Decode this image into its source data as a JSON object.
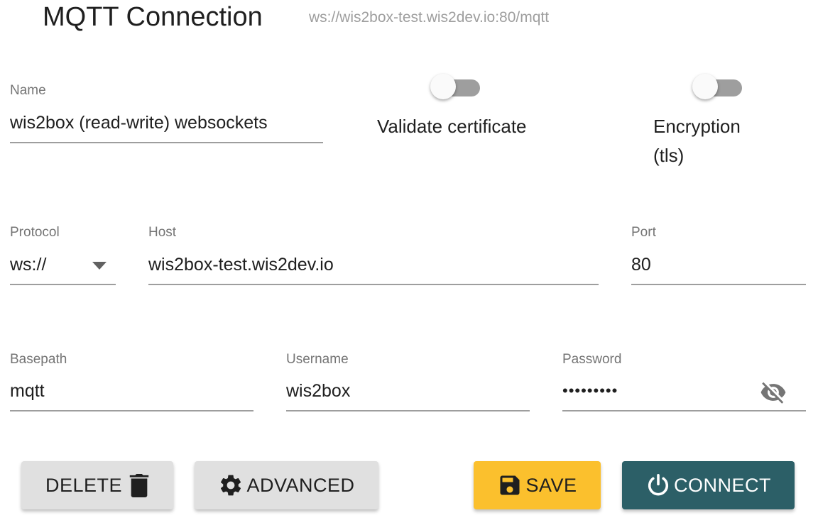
{
  "header": {
    "title": "MQTT Connection",
    "url": "ws://wis2box-test.wis2dev.io:80/mqtt"
  },
  "fields": {
    "name": {
      "label": "Name",
      "value": "wis2box (read-write) websockets"
    },
    "protocol": {
      "label": "Protocol",
      "value": "ws://"
    },
    "host": {
      "label": "Host",
      "value": "wis2box-test.wis2dev.io"
    },
    "port": {
      "label": "Port",
      "value": "80"
    },
    "basepath": {
      "label": "Basepath",
      "value": "mqtt"
    },
    "username": {
      "label": "Username",
      "value": "wis2box"
    },
    "password": {
      "label": "Password",
      "value": "•••••••••"
    }
  },
  "switches": {
    "validate_certificate": {
      "label": "Validate certificate",
      "on": false
    },
    "encryption": {
      "label_line1": "Encryption",
      "label_line2": "(tls)",
      "on": false
    }
  },
  "buttons": {
    "delete": "DELETE",
    "advanced": "ADVANCED",
    "save": "SAVE",
    "connect": "CONNECT"
  },
  "icons": {
    "protocol_dropdown": "chevron-down-icon",
    "password_toggle": "eye-off-icon",
    "delete": "trash-icon",
    "advanced": "gear-icon",
    "save": "floppy-disk-icon",
    "connect": "power-icon"
  },
  "colors": {
    "save_button": "#fbc02d",
    "connect_button": "#2c5f67",
    "secondary_button": "#e0e0e0"
  }
}
